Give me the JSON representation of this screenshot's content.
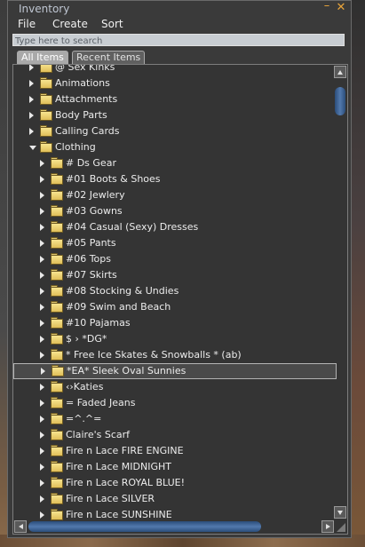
{
  "window": {
    "title": "Inventory",
    "minimize_glyph": "–",
    "close_glyph": "✕"
  },
  "menu": [
    {
      "label": "File"
    },
    {
      "label": "Create"
    },
    {
      "label": "Sort"
    }
  ],
  "search": {
    "placeholder": "Type here to search",
    "value": ""
  },
  "tabs": [
    {
      "label": "All Items",
      "active": true
    },
    {
      "label": "Recent Items",
      "active": false
    }
  ],
  "tree": {
    "items": [
      {
        "label": "@ Sex Kinks",
        "depth": 1,
        "expanded": false,
        "icon": "folder-icon"
      },
      {
        "label": "Animations",
        "depth": 1,
        "expanded": false,
        "icon": "animations-folder-icon"
      },
      {
        "label": "Attachments",
        "depth": 1,
        "expanded": false,
        "icon": "folder-icon"
      },
      {
        "label": "Body Parts",
        "depth": 1,
        "expanded": false,
        "icon": "bodyparts-folder-icon"
      },
      {
        "label": "Calling Cards",
        "depth": 1,
        "expanded": false,
        "icon": "callingcards-folder-icon"
      },
      {
        "label": "Clothing",
        "depth": 1,
        "expanded": true,
        "icon": "clothing-folder-icon"
      },
      {
        "label": "# Ds Gear",
        "depth": 2,
        "expanded": false,
        "icon": "folder-icon"
      },
      {
        "label": "#01 Boots & Shoes",
        "depth": 2,
        "expanded": false,
        "icon": "folder-icon"
      },
      {
        "label": "#02 Jewlery",
        "depth": 2,
        "expanded": false,
        "icon": "folder-icon"
      },
      {
        "label": "#03 Gowns",
        "depth": 2,
        "expanded": false,
        "icon": "folder-icon"
      },
      {
        "label": "#04 Casual (Sexy) Dresses",
        "depth": 2,
        "expanded": false,
        "icon": "folder-icon"
      },
      {
        "label": "#05 Pants",
        "depth": 2,
        "expanded": false,
        "icon": "folder-icon"
      },
      {
        "label": "#06 Tops",
        "depth": 2,
        "expanded": false,
        "icon": "folder-icon"
      },
      {
        "label": "#07 Skirts",
        "depth": 2,
        "expanded": false,
        "icon": "folder-icon"
      },
      {
        "label": "#08 Stocking & Undies",
        "depth": 2,
        "expanded": false,
        "icon": "folder-icon"
      },
      {
        "label": "#09 Swim and Beach",
        "depth": 2,
        "expanded": false,
        "icon": "folder-icon"
      },
      {
        "label": "#10 Pajamas",
        "depth": 2,
        "expanded": false,
        "icon": "folder-icon"
      },
      {
        "label": "$ › *DG*",
        "depth": 2,
        "expanded": false,
        "icon": "folder-icon"
      },
      {
        "label": "* Free Ice Skates & Snowballs * (ab)",
        "depth": 2,
        "expanded": false,
        "icon": "folder-icon"
      },
      {
        "label": "*EA* Sleek Oval Sunnies",
        "depth": 2,
        "expanded": false,
        "icon": "folder-icon",
        "selected": true
      },
      {
        "label": "‹›Katies",
        "depth": 2,
        "expanded": false,
        "icon": "folder-icon"
      },
      {
        "label": "= Faded Jeans",
        "depth": 2,
        "expanded": false,
        "icon": "folder-icon"
      },
      {
        "label": "=^.^=",
        "depth": 2,
        "expanded": false,
        "icon": "folder-icon"
      },
      {
        "label": "Claire's Scarf",
        "depth": 2,
        "expanded": false,
        "icon": "folder-icon"
      },
      {
        "label": "Fire n Lace FIRE ENGINE",
        "depth": 2,
        "expanded": false,
        "icon": "folder-icon"
      },
      {
        "label": "Fire n Lace MIDNIGHT",
        "depth": 2,
        "expanded": false,
        "icon": "folder-icon"
      },
      {
        "label": "Fire n Lace ROYAL BLUE!",
        "depth": 2,
        "expanded": false,
        "icon": "folder-icon"
      },
      {
        "label": "Fire n Lace SILVER",
        "depth": 2,
        "expanded": false,
        "icon": "folder-icon"
      },
      {
        "label": "Fire n Lace SUNSHINE",
        "depth": 2,
        "expanded": false,
        "icon": "folder-icon"
      }
    ]
  },
  "colors": {
    "accent": "#e9a43a",
    "folder": "#f1d878",
    "scroll_thumb": "#4a6fa5",
    "panel_bg": "#343434"
  }
}
